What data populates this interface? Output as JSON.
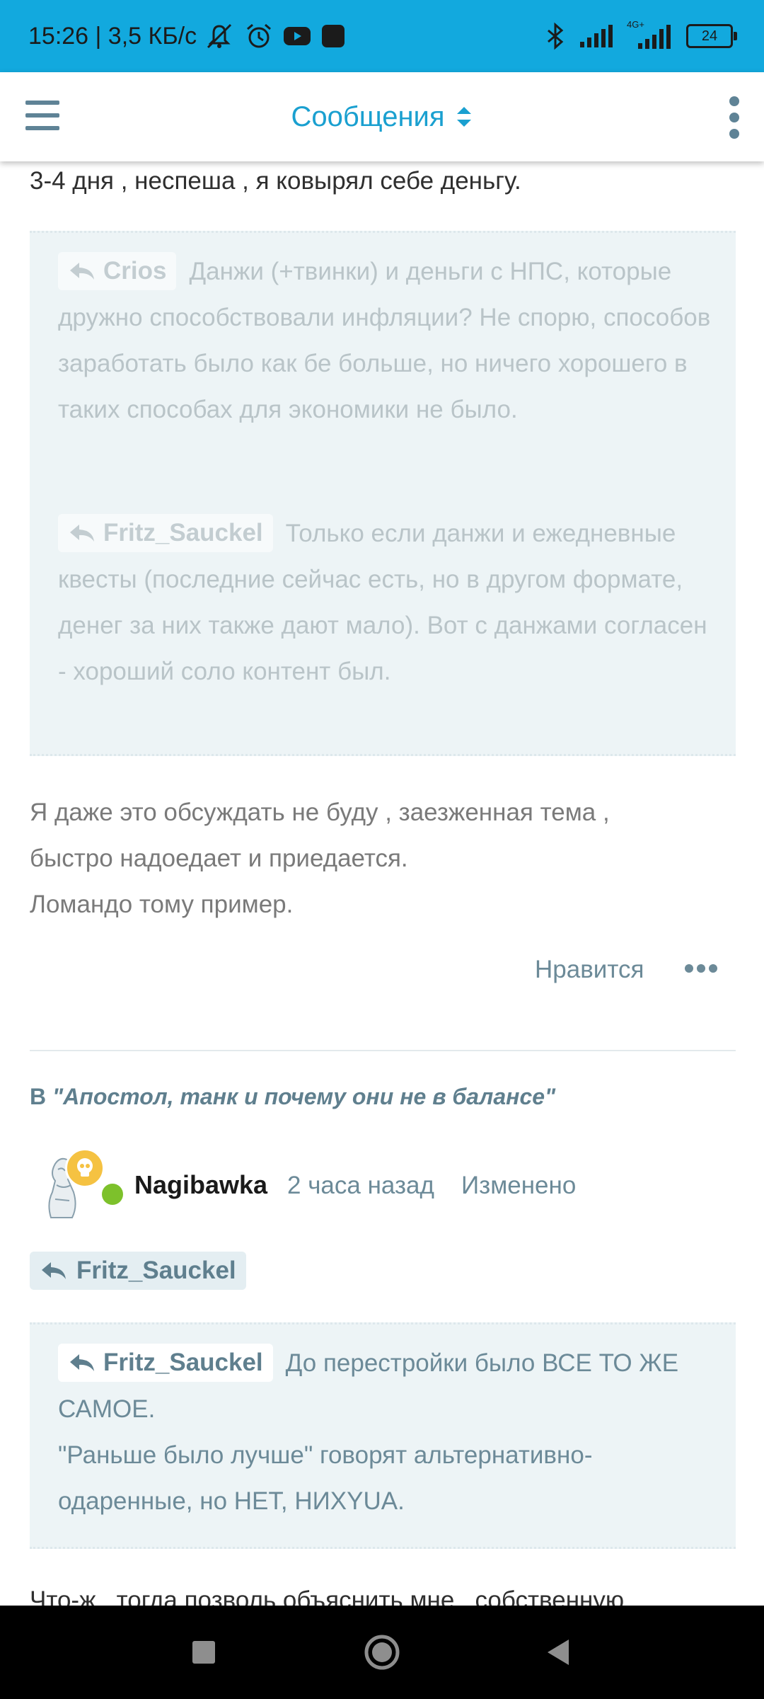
{
  "status_bar": {
    "time_speed": "15:26 | 3,5 КБ/с",
    "network": "4G+",
    "battery": "24",
    "icons": [
      "bell-muted-icon",
      "alarm-icon",
      "youtube-icon",
      "app-icon",
      "bluetooth-icon",
      "signal-icon",
      "signal-4g-icon",
      "battery-icon"
    ]
  },
  "app_bar": {
    "title": "Сообщения",
    "icons": [
      "menu-icon",
      "sort-icon",
      "more-vert-icon"
    ]
  },
  "post1": {
    "top_text": "3-4 дня , неспеша , я ковырял себе деньгу.",
    "quotes": [
      {
        "author": "Crios",
        "text": "Данжи (+твинки) и деньги с НПС, которые дружно способствовали инфляции? Не спорю, способов заработать было как бе больше, но ничего хорошего в таких способах для экономики не было."
      },
      {
        "author": "Fritz_Sauckel",
        "text": "Только если данжи и ежедневные квесты (последние сейчас есть, но в другом формате, денег за них также дают мало). Вот с данжами согласен - хороший соло контент был."
      }
    ],
    "body": [
      "Я даже это обсуждать не буду , заезженная тема ,",
      "быстро надоедает и приедается.",
      "Ломандо тому пример."
    ],
    "like_label": "Нравится"
  },
  "post2": {
    "topic_prefix": "В ",
    "topic": "\"Апостол, танк и почему они не в балансе\"",
    "author": "Nagibawka",
    "time": "2 часа назад",
    "edited_label": "Изменено",
    "reply_to": "Fritz_Sauckel",
    "quote": {
      "author": "Fritz_Sauckel",
      "line1": "До перестройки было ВСЕ ТО ЖЕ САМОЕ.",
      "line2": "\"Раньше было лучше\" говорят альтернативно-одаренные, но НЕТ, НИXYUA."
    },
    "body_start": "Что-ж , тогда позволь объяснить мне , собственную"
  },
  "colors": {
    "status_bar": "#12a9de",
    "accent": "#1aa0d0",
    "quote_bg": "#edf4f6",
    "online": "#7dc12b"
  }
}
